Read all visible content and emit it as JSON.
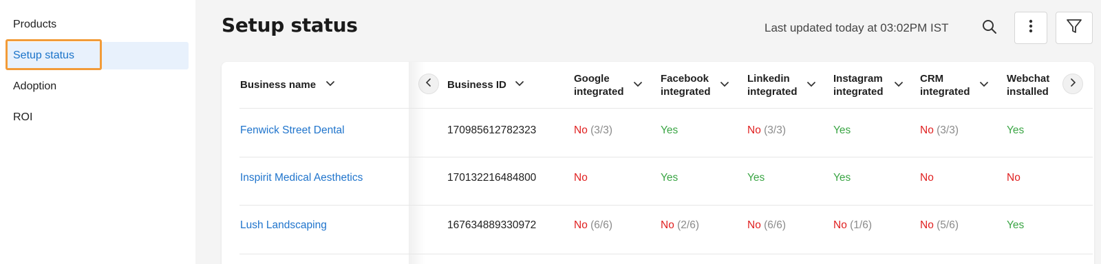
{
  "sidebar": {
    "items": [
      {
        "label": "Products",
        "active": false
      },
      {
        "label": "Setup status",
        "active": true
      },
      {
        "label": "Adoption",
        "active": false
      },
      {
        "label": "ROI",
        "active": false
      }
    ]
  },
  "header": {
    "title": "Setup status",
    "last_updated": "Last updated today at 03:02PM IST",
    "icons": [
      "search-icon",
      "more-vertical-icon",
      "filter-icon"
    ]
  },
  "table": {
    "columns": [
      {
        "label": "Business name"
      },
      {
        "label": "Business ID"
      },
      {
        "line1": "Google",
        "line2": "integrated"
      },
      {
        "line1": "Facebook",
        "line2": "integrated"
      },
      {
        "line1": "Linkedin",
        "line2": "integrated"
      },
      {
        "line1": "Instagram",
        "line2": "integrated"
      },
      {
        "line1": "CRM",
        "line2": "integrated"
      },
      {
        "line1": "Webchat",
        "line2": "installed"
      }
    ],
    "rows": [
      {
        "name": "Fenwick Street Dental",
        "id": "170985612782323",
        "google": {
          "status": "No",
          "count": "(3/3)"
        },
        "facebook": {
          "status": "Yes",
          "count": ""
        },
        "linkedin": {
          "status": "No",
          "count": "(3/3)"
        },
        "instagram": {
          "status": "Yes",
          "count": ""
        },
        "crm": {
          "status": "No",
          "count": "(3/3)"
        },
        "webchat": {
          "status": "Yes",
          "count": ""
        }
      },
      {
        "name": "Inspirit Medical Aesthetics",
        "id": "170132216484800",
        "google": {
          "status": "No",
          "count": ""
        },
        "facebook": {
          "status": "Yes",
          "count": ""
        },
        "linkedin": {
          "status": "Yes",
          "count": ""
        },
        "instagram": {
          "status": "Yes",
          "count": ""
        },
        "crm": {
          "status": "No",
          "count": ""
        },
        "webchat": {
          "status": "No",
          "count": ""
        }
      },
      {
        "name": "Lush Landscaping",
        "id": "167634889330972",
        "google": {
          "status": "No",
          "count": "(6/6)"
        },
        "facebook": {
          "status": "No",
          "count": "(2/6)"
        },
        "linkedin": {
          "status": "No",
          "count": "(6/6)"
        },
        "instagram": {
          "status": "No",
          "count": "(1/6)"
        },
        "crm": {
          "status": "No",
          "count": "(5/6)"
        },
        "webchat": {
          "status": "Yes",
          "count": ""
        }
      }
    ]
  },
  "colors": {
    "accent": "#1f74cc",
    "yes": "#3aa544",
    "no": "#e02020",
    "focus": "#f29b38"
  }
}
